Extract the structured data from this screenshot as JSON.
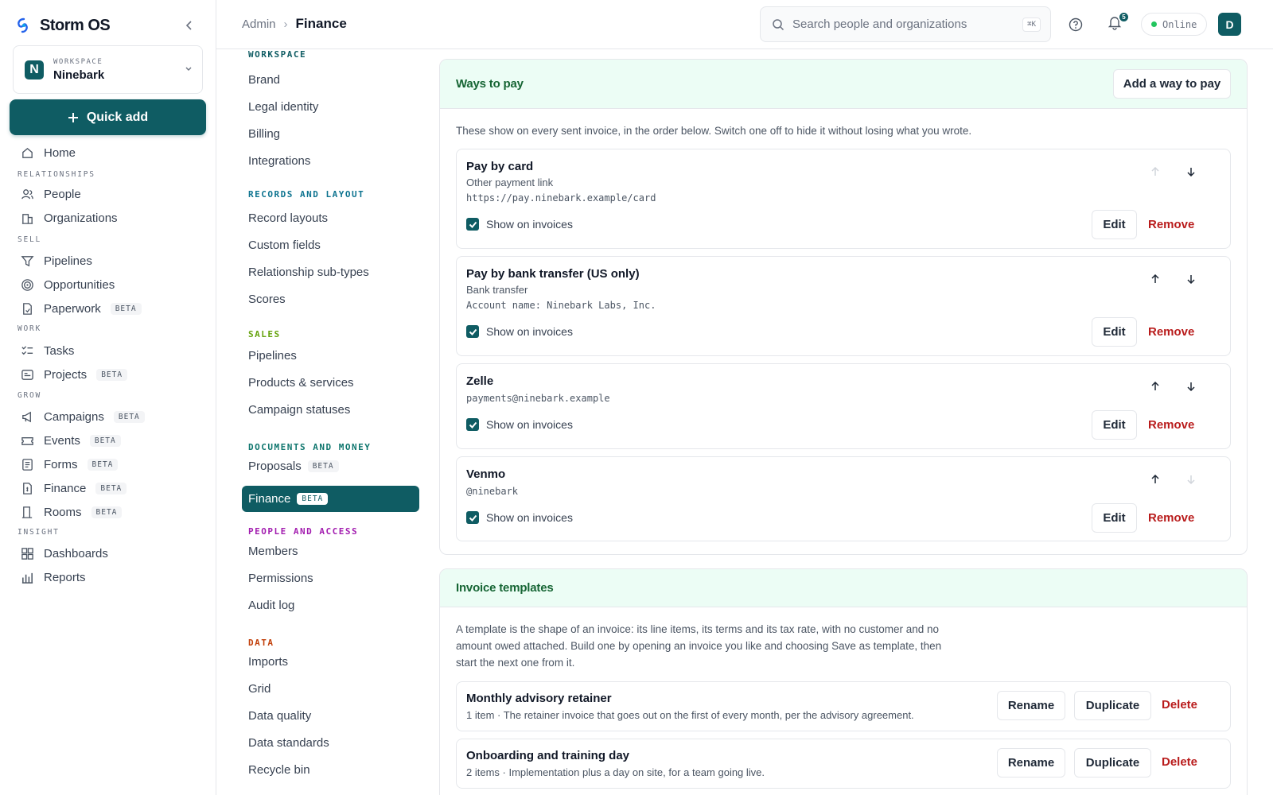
{
  "app": {
    "name": "Storm OS"
  },
  "workspace": {
    "caption": "WORKSPACE",
    "name": "Ninebark",
    "initial": "N"
  },
  "quick_add": {
    "label": "Quick add"
  },
  "sidebar": {
    "home": "Home",
    "sections": [
      {
        "caption": "RELATIONSHIPS",
        "items": [
          "People",
          "Organizations"
        ]
      },
      {
        "caption": "SELL",
        "items": [
          "Pipelines",
          "Opportunities",
          "Paperwork"
        ]
      },
      {
        "caption": "WORK",
        "items": [
          "Tasks",
          "Projects"
        ]
      },
      {
        "caption": "GROW",
        "items": [
          "Campaigns",
          "Events",
          "Forms",
          "Finance",
          "Rooms"
        ]
      },
      {
        "caption": "INSIGHT",
        "items": [
          "Dashboards",
          "Reports"
        ]
      }
    ],
    "beta_label": "BETA"
  },
  "topbar": {
    "breadcrumb": [
      "Admin",
      "Finance"
    ],
    "search_placeholder": "Search people and organizations",
    "search_shortcut": "⌘K",
    "notifications_count": "5",
    "status": "Online",
    "user_initial": "D"
  },
  "settings_nav": {
    "sections": [
      {
        "caption": "WORKSPACE",
        "color": "#0f5c63",
        "items": [
          "Brand",
          "Legal identity",
          "Billing",
          "Integrations"
        ]
      },
      {
        "caption": "RECORDS AND LAYOUT",
        "color": "#0e7490",
        "items": [
          "Record layouts",
          "Custom fields",
          "Relationship sub-types",
          "Scores"
        ]
      },
      {
        "caption": "SALES",
        "color": "#65a30d",
        "items": [
          "Pipelines",
          "Products & services",
          "Campaign statuses"
        ]
      },
      {
        "caption": "DOCUMENTS AND MONEY",
        "color": "#0f766e",
        "items": [
          "Proposals",
          "Finance"
        ]
      },
      {
        "caption": "PEOPLE AND ACCESS",
        "color": "#a21caf",
        "items": [
          "Members",
          "Permissions",
          "Audit log"
        ]
      },
      {
        "caption": "DATA",
        "color": "#c2410c",
        "items": [
          "Imports",
          "Grid",
          "Data quality",
          "Data standards",
          "Recycle bin"
        ]
      }
    ],
    "beta_label": "BETA",
    "active": "Finance"
  },
  "ways_to_pay": {
    "title": "Ways to pay",
    "add_label": "Add a way to pay",
    "description": "These show on every sent invoice, in the order below. Switch one off to hide it without losing what you wrote.",
    "show_label": "Show on invoices",
    "edit_label": "Edit",
    "remove_label": "Remove",
    "methods": [
      {
        "name": "Pay by card",
        "type": "Other payment link",
        "detail": "https://pay.ninebark.example/card",
        "shown": true
      },
      {
        "name": "Pay by bank transfer (US only)",
        "type": "Bank transfer",
        "detail": "Account name: Ninebark Labs, Inc.",
        "shown": true
      },
      {
        "name": "Zelle",
        "type": "",
        "detail": "payments@ninebark.example",
        "shown": true
      },
      {
        "name": "Venmo",
        "type": "",
        "detail": "@ninebark",
        "shown": true
      }
    ]
  },
  "invoice_templates": {
    "title": "Invoice templates",
    "description": "A template is the shape of an invoice: its line items, its terms and its tax rate, with no customer and no amount owed attached. Build one by opening an invoice you like and choosing Save as template, then start the next one from it.",
    "rename_label": "Rename",
    "duplicate_label": "Duplicate",
    "delete_label": "Delete",
    "templates": [
      {
        "name": "Monthly advisory retainer",
        "summary": "1 item · The retainer invoice that goes out on the first of every month, per the advisory agreement."
      },
      {
        "name": "Onboarding and training day",
        "summary": "2 items · Implementation plus a day on site, for a team going live."
      }
    ]
  },
  "colors": {
    "accent": "#0f5c63",
    "danger": "#b91c1c",
    "section_header_bg": "#ecfdf5",
    "section_title": "#166534"
  }
}
